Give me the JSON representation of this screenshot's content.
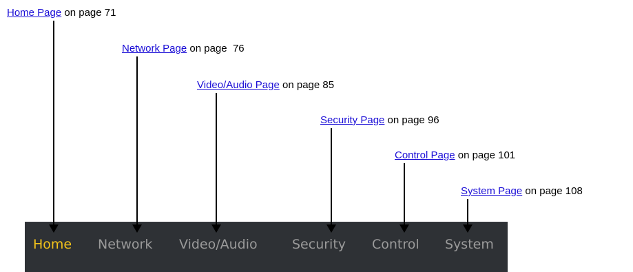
{
  "callouts": [
    {
      "id": "home",
      "link": "Home Page",
      "suffix": " on page 71"
    },
    {
      "id": "network",
      "link": "Network Page",
      "suffix": " on page  76"
    },
    {
      "id": "video-audio",
      "link": "Video/Audio Page",
      "suffix": " on page 85"
    },
    {
      "id": "security",
      "link": "Security Page",
      "suffix": " on page 96"
    },
    {
      "id": "control",
      "link": "Control Page",
      "suffix": " on page 101"
    },
    {
      "id": "system",
      "link": "System Page",
      "suffix": " on page 108"
    }
  ],
  "navbar": {
    "items": [
      "Home",
      "Network",
      "Video/Audio",
      "Security",
      "Control",
      "System"
    ],
    "active": "Home"
  },
  "colors": {
    "link": "#1a0dd6",
    "navbar_bg": "#2e3135",
    "nav_active": "#f2c21b",
    "nav_inactive": "#9a9a9a",
    "arrow": "#000000"
  }
}
